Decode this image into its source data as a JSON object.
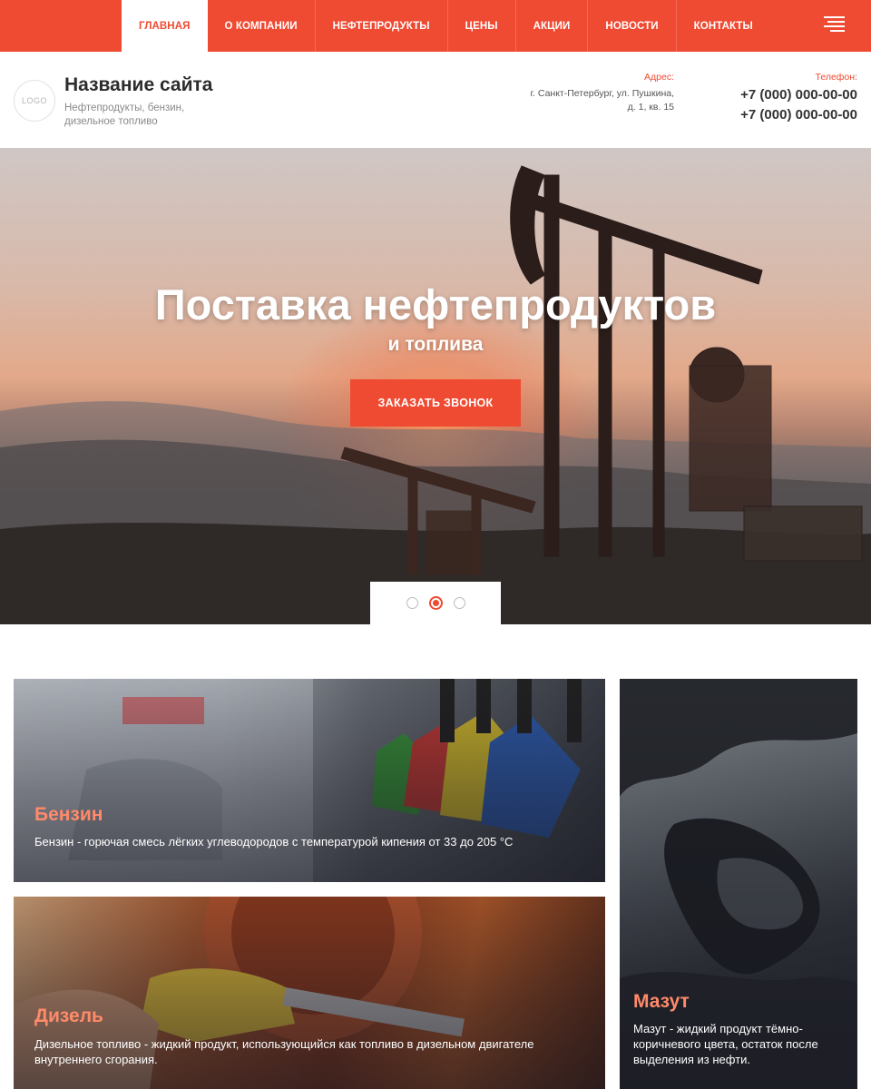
{
  "nav": {
    "items": [
      {
        "label": "ГЛАВНАЯ",
        "active": true
      },
      {
        "label": "О КОМПАНИИ"
      },
      {
        "label": "НЕФТЕПРОДУКТЫ"
      },
      {
        "label": "ЦЕНЫ"
      },
      {
        "label": "АКЦИИ"
      },
      {
        "label": "НОВОСТИ"
      },
      {
        "label": "КОНТАКТЫ"
      }
    ],
    "menu_icon": "hamburger-menu-icon"
  },
  "header": {
    "logo_text": "LOGO",
    "site_title": "Название сайта",
    "site_subtitle": "Нефтепродукты, бензин, дизельное топливо",
    "address_label": "Адрес:",
    "address_line1": "г. Санкт-Петербург, ул. Пушкина,",
    "address_line2": "д. 1, кв. 15",
    "phone_label": "Телефон:",
    "phone1": "+7 (000) 000-00-00",
    "phone2": "+7 (000) 000-00-00"
  },
  "hero": {
    "title": "Поставка нефтепродуктов",
    "subtitle": "и топлива",
    "cta_label": "ЗАКАЗАТЬ ЗВОНОК",
    "slides_count": 3,
    "active_slide": 2
  },
  "cards": {
    "benzin": {
      "title": "Бензин",
      "text": "Бензин - горючая смесь лёгких углеводородов с температурой кипения от 33 до 205 °C"
    },
    "diesel": {
      "title": "Дизель",
      "text": "Дизельное топливо - жидкий продукт, использующийся как топливо в дизельном двигателе внутреннего сгорания."
    },
    "mazut": {
      "title": "Мазут",
      "text": "Мазут - жидкий продукт тёмно-коричневого цвета, остаток после выделения из нефти."
    }
  },
  "colors": {
    "accent": "#ef4a32",
    "card_title": "#ff8a6a"
  }
}
